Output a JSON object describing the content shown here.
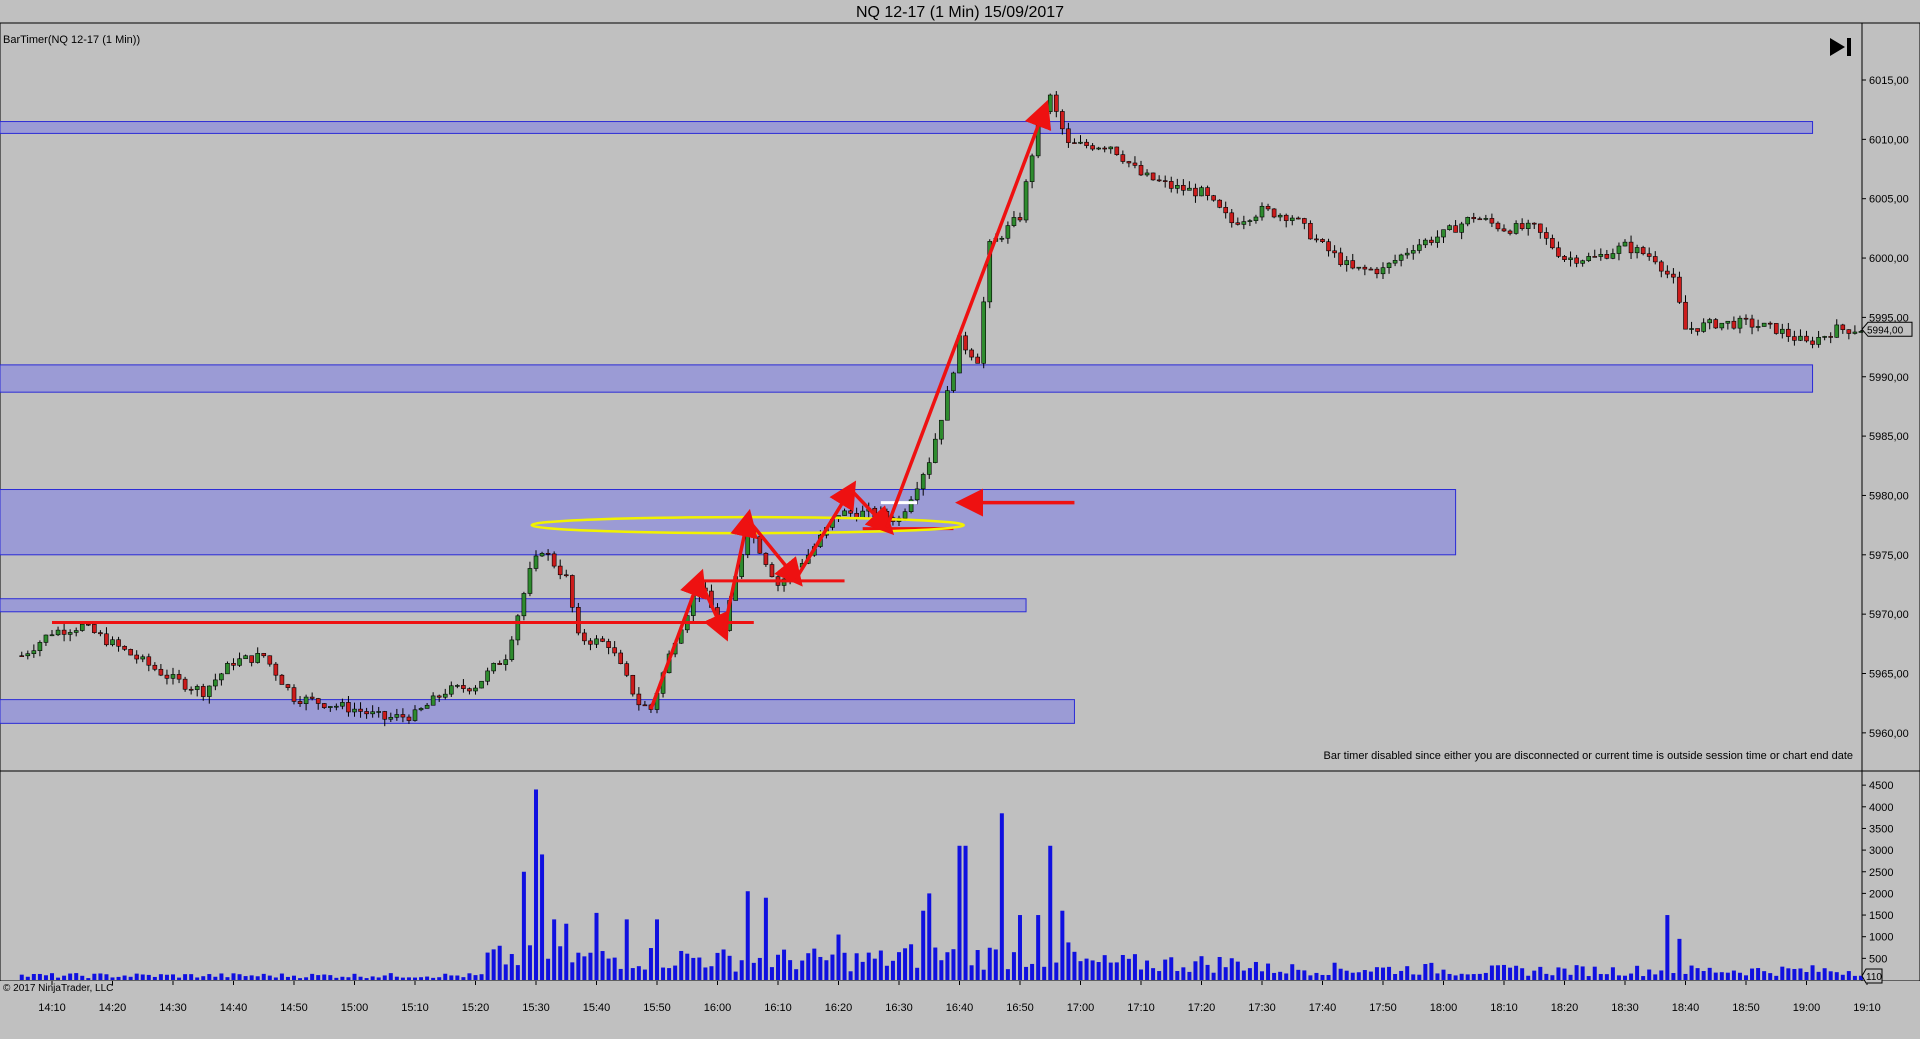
{
  "window": {
    "title": "NQ 12-17 (1 Min)  15/09/2017"
  },
  "chart_data": [
    {
      "type": "candlestick",
      "instrument": "NQ 12-17",
      "indicator_label": "BarTimer(NQ 12-17 (1 Min))",
      "ylim": [
        5957,
        6018
      ],
      "y_ticks": [
        "5960,00",
        "5965,00",
        "5970,00",
        "5975,00",
        "5980,00",
        "5985,00",
        "5990,00",
        "5995,00",
        "6000,00",
        "6005,00",
        "6010,00",
        "6015,00"
      ],
      "last_price_label": "5994,00",
      "status_message": "Bar timer disabled since either you are disconnected or current time is outside session time or chart end date",
      "zones": [
        {
          "low": 6010.5,
          "high": 6011.5,
          "end_minute": 1141
        },
        {
          "low": 5988.7,
          "high": 5991.0,
          "end_minute": 1141
        },
        {
          "low": 5975.0,
          "high": 5980.5,
          "end_minute": 1082
        },
        {
          "low": 5970.2,
          "high": 5971.3,
          "end_minute": 1011
        },
        {
          "low": 5960.8,
          "high": 5962.8,
          "end_minute": 1019
        }
      ],
      "key_points": [
        {
          "time": "14:05",
          "price": 5966.5
        },
        {
          "time": "14:10",
          "price": 5968.5
        },
        {
          "time": "14:15",
          "price": 5969.0
        },
        {
          "time": "14:20",
          "price": 5967.5
        },
        {
          "time": "14:30",
          "price": 5964.5
        },
        {
          "time": "14:35",
          "price": 5963.5
        },
        {
          "time": "14:40",
          "price": 5966.0
        },
        {
          "time": "14:45",
          "price": 5966.5
        },
        {
          "time": "14:50",
          "price": 5963.0
        },
        {
          "time": "15:00",
          "price": 5962.0
        },
        {
          "time": "15:05",
          "price": 5961.2
        },
        {
          "time": "15:10",
          "price": 5961.5
        },
        {
          "time": "15:15",
          "price": 5963.5
        },
        {
          "time": "15:20",
          "price": 5964.0
        },
        {
          "time": "15:25",
          "price": 5966.5
        },
        {
          "time": "15:29",
          "price": 5973.5
        },
        {
          "time": "15:31",
          "price": 5975.5
        },
        {
          "time": "15:35",
          "price": 5973.0
        },
        {
          "time": "15:37",
          "price": 5968.0
        },
        {
          "time": "15:42",
          "price": 5967.5
        },
        {
          "time": "15:47",
          "price": 5962.5
        },
        {
          "time": "15:49",
          "price": 5962.0
        },
        {
          "time": "15:53",
          "price": 5968.0
        },
        {
          "time": "15:57",
          "price": 5972.5
        },
        {
          "time": "16:01",
          "price": 5968.5
        },
        {
          "time": "16:05",
          "price": 5977.5
        },
        {
          "time": "16:10",
          "price": 5972.5
        },
        {
          "time": "16:15",
          "price": 5975.0
        },
        {
          "time": "16:20",
          "price": 5978.5
        },
        {
          "time": "16:25",
          "price": 5978.5
        },
        {
          "time": "16:30",
          "price": 5978.0
        },
        {
          "time": "16:35",
          "price": 5983.0
        },
        {
          "time": "16:38",
          "price": 5988.5
        },
        {
          "time": "16:40",
          "price": 5993.0
        },
        {
          "time": "16:43",
          "price": 5991.5
        },
        {
          "time": "16:45",
          "price": 6001.0
        },
        {
          "time": "16:50",
          "price": 6003.5
        },
        {
          "time": "16:53",
          "price": 6011.5
        },
        {
          "time": "16:55",
          "price": 6013.5
        },
        {
          "time": "16:58",
          "price": 6009.5
        },
        {
          "time": "17:05",
          "price": 6009.5
        },
        {
          "time": "17:10",
          "price": 6007.0
        },
        {
          "time": "17:15",
          "price": 6006.0
        },
        {
          "time": "17:20",
          "price": 6005.5
        },
        {
          "time": "17:25",
          "price": 6003.0
        },
        {
          "time": "17:30",
          "price": 6004.0
        },
        {
          "time": "17:35",
          "price": 6003.5
        },
        {
          "time": "17:40",
          "price": 6001.0
        },
        {
          "time": "17:45",
          "price": 5999.0
        },
        {
          "time": "17:50",
          "price": 5999.0
        },
        {
          "time": "17:55",
          "price": 6001.0
        },
        {
          "time": "18:00",
          "price": 6002.0
        },
        {
          "time": "18:05",
          "price": 6003.5
        },
        {
          "time": "18:10",
          "price": 6002.5
        },
        {
          "time": "18:15",
          "price": 6002.5
        },
        {
          "time": "18:20",
          "price": 6000.0
        },
        {
          "time": "18:25",
          "price": 6000.0
        },
        {
          "time": "18:30",
          "price": 6001.0
        },
        {
          "time": "18:35",
          "price": 6000.0
        },
        {
          "time": "18:38",
          "price": 5998.0
        },
        {
          "time": "18:40",
          "price": 5994.0
        },
        {
          "time": "18:45",
          "price": 5994.5
        },
        {
          "time": "18:50",
          "price": 5994.5
        },
        {
          "time": "18:55",
          "price": 5994.0
        },
        {
          "time": "19:00",
          "price": 5992.8
        },
        {
          "time": "19:05",
          "price": 5994.0
        },
        {
          "time": "19:09",
          "price": 5994.0
        }
      ],
      "annotations": {
        "hlines": [
          {
            "price": 5969.3,
            "from": "14:10",
            "to": "16:06"
          },
          {
            "price": 5972.8,
            "from": "15:57",
            "to": "16:21"
          },
          {
            "price": 5977.2,
            "from": "16:24",
            "to": "16:39"
          },
          {
            "price": 5979.4,
            "from": "16:27",
            "to": "16:33",
            "color": "#ffffff"
          }
        ],
        "ellipse": {
          "center_time": "16:05",
          "center_price": 5977.5
        },
        "arrow_polyline": [
          {
            "time": "15:49",
            "price": 5962.0
          },
          {
            "time": "15:57",
            "price": 5973.0
          },
          {
            "time": "16:01",
            "price": 5968.5
          },
          {
            "time": "16:05",
            "price": 5978.0
          },
          {
            "time": "16:13",
            "price": 5973.0
          },
          {
            "time": "16:22",
            "price": 5980.5
          },
          {
            "time": "16:28",
            "price": 5977.3
          },
          {
            "time": "16:54",
            "price": 6012.5
          }
        ],
        "arrow_left": {
          "price": 5979.4,
          "from": "16:59",
          "to": "16:41"
        }
      }
    },
    {
      "type": "bar",
      "series_name": "Volume",
      "ylim": [
        0,
        4700
      ],
      "y_ticks": [
        "500",
        "1000",
        "1500",
        "2000",
        "2500",
        "3000",
        "3500",
        "4000",
        "4500"
      ],
      "last_value_label": "110",
      "copyright": "© 2017 NinjaTrader, LLC",
      "x_ticks": [
        "14:10",
        "14:20",
        "14:30",
        "14:40",
        "14:50",
        "15:00",
        "15:10",
        "15:20",
        "15:30",
        "15:40",
        "15:50",
        "16:00",
        "16:10",
        "16:20",
        "16:30",
        "16:40",
        "16:50",
        "17:00",
        "17:10",
        "17:20",
        "17:30",
        "17:40",
        "17:50",
        "18:00",
        "18:10",
        "18:20",
        "18:30",
        "18:40",
        "18:50",
        "19:00",
        "19:10"
      ],
      "key_values": [
        {
          "time": "15:28",
          "value": 2500
        },
        {
          "time": "15:30",
          "value": 4400
        },
        {
          "time": "15:31",
          "value": 2900
        },
        {
          "time": "15:33",
          "value": 1400
        },
        {
          "time": "15:35",
          "value": 1300
        },
        {
          "time": "15:40",
          "value": 1550
        },
        {
          "time": "15:45",
          "value": 1400
        },
        {
          "time": "15:50",
          "value": 1400
        },
        {
          "time": "16:05",
          "value": 2050
        },
        {
          "time": "16:08",
          "value": 1900
        },
        {
          "time": "16:20",
          "value": 1050
        },
        {
          "time": "16:34",
          "value": 1600
        },
        {
          "time": "16:35",
          "value": 2000
        },
        {
          "time": "16:40",
          "value": 3100
        },
        {
          "time": "16:41",
          "value": 3100
        },
        {
          "time": "16:47",
          "value": 3850
        },
        {
          "time": "16:50",
          "value": 1500
        },
        {
          "time": "16:53",
          "value": 1500
        },
        {
          "time": "16:55",
          "value": 3100
        },
        {
          "time": "16:57",
          "value": 1600
        },
        {
          "time": "18:37",
          "value": 1500
        },
        {
          "time": "18:39",
          "value": 950
        }
      ]
    }
  ]
}
